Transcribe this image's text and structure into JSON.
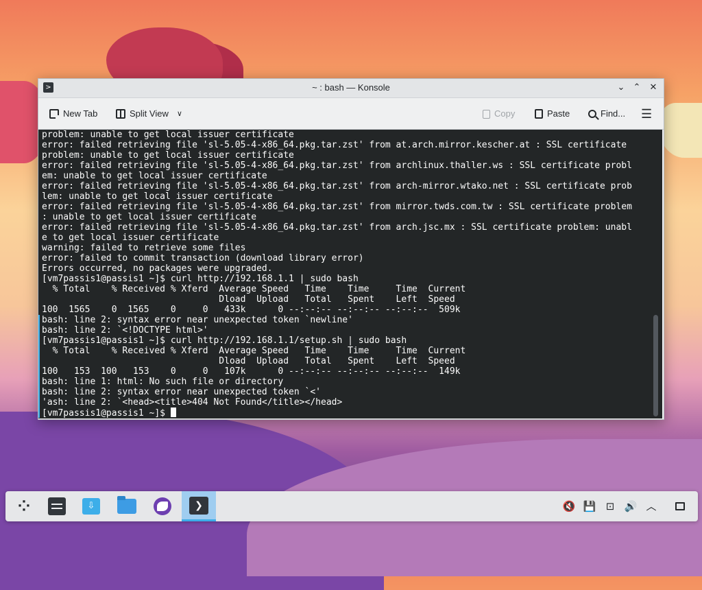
{
  "window": {
    "title": "~ : bash — Konsole",
    "app_icon": "terminal-icon",
    "controls": {
      "minimize": "⌄",
      "maximize": "⌃",
      "close": "✕"
    }
  },
  "toolbar": {
    "new_tab_label": "New Tab",
    "split_view_label": "Split View",
    "copy_label": "Copy",
    "paste_label": "Paste",
    "find_label": "Find...",
    "menu_glyph": "☰",
    "split_chevron": "∨"
  },
  "terminal": {
    "lines": [
      "problem: unable to get local issuer certificate",
      "error: failed retrieving file 'sl-5.05-4-x86_64.pkg.tar.zst' from at.arch.mirror.kescher.at : SSL certificate",
      "problem: unable to get local issuer certificate",
      "error: failed retrieving file 'sl-5.05-4-x86_64.pkg.tar.zst' from archlinux.thaller.ws : SSL certificate probl",
      "em: unable to get local issuer certificate",
      "error: failed retrieving file 'sl-5.05-4-x86_64.pkg.tar.zst' from arch-mirror.wtako.net : SSL certificate prob",
      "lem: unable to get local issuer certificate",
      "error: failed retrieving file 'sl-5.05-4-x86_64.pkg.tar.zst' from mirror.twds.com.tw : SSL certificate problem",
      ": unable to get local issuer certificate",
      "error: failed retrieving file 'sl-5.05-4-x86_64.pkg.tar.zst' from arch.jsc.mx : SSL certificate problem: unabl",
      "e to get local issuer certificate",
      "warning: failed to retrieve some files",
      "error: failed to commit transaction (download library error)",
      "Errors occurred, no packages were upgraded.",
      "[vm7passis1@passis1 ~]$ curl http://192.168.1.1 | sudo bash",
      "  % Total    % Received % Xferd  Average Speed   Time    Time     Time  Current",
      "                                 Dload  Upload   Total   Spent    Left  Speed",
      "100  1565    0  1565    0     0   433k      0 --:--:-- --:--:-- --:--:--  509k",
      "bash: line 2: syntax error near unexpected token `newline'",
      "bash: line 2: `<!DOCTYPE html>'",
      "[vm7passis1@passis1 ~]$ curl http://192.168.1.1/setup.sh | sudo bash",
      "  % Total    % Received % Xferd  Average Speed   Time    Time     Time  Current",
      "                                 Dload  Upload   Total   Spent    Left  Speed",
      "100   153  100   153    0     0   107k      0 --:--:-- --:--:-- --:--:--  149k",
      "bash: line 1: html: No such file or directory",
      "bash: line 2: syntax error near unexpected token `<'",
      "'ash: line 2: `<head><title>404 Not Found</title></head>",
      "[vm7passis1@passis1 ~]$ "
    ]
  },
  "taskbar": {
    "launcher_glyph": "⁘",
    "discover_glyph": "⇩",
    "konsole_glyph": "❯",
    "tray": {
      "mute_glyph": "🔇",
      "save_glyph": "💾",
      "network_glyph": "⊡",
      "volume_glyph": "🔊",
      "expand_glyph": "︿"
    }
  }
}
